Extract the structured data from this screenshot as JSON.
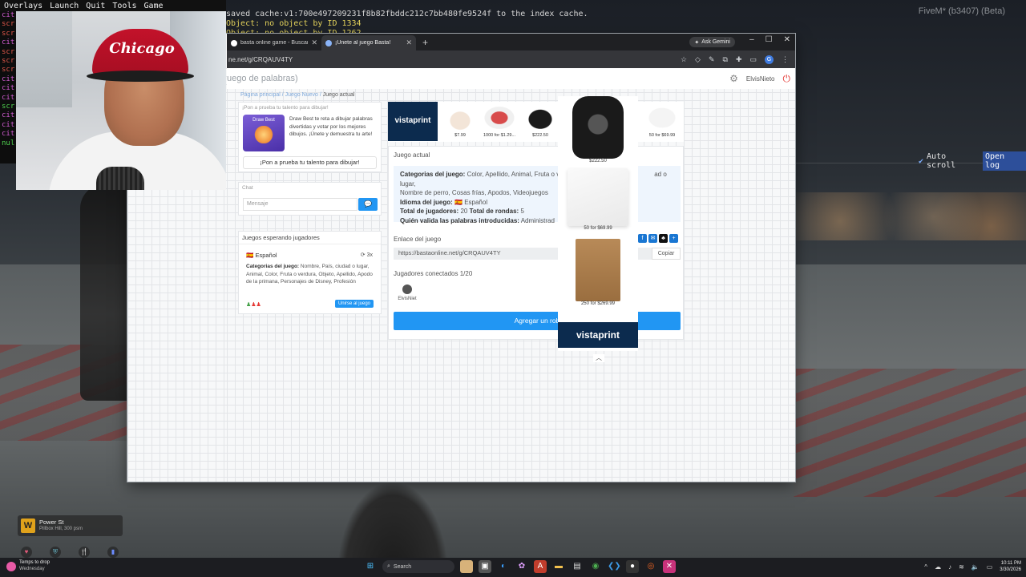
{
  "menubar": {
    "items": [
      "Overlays",
      "Launch",
      "Quit",
      "Tools",
      "Game"
    ]
  },
  "console_left": [
    {
      "t": "cit",
      "c": "#d15bd1"
    },
    {
      "t": "scr",
      "c": "#e0574a"
    },
    {
      "t": "scr",
      "c": "#e0574a"
    },
    {
      "t": "cit",
      "c": "#d15bd1"
    },
    {
      "t": "scr",
      "c": "#e0574a"
    },
    {
      "t": "scr",
      "c": "#e0574a"
    },
    {
      "t": "scr",
      "c": "#e0574a"
    },
    {
      "t": "cit",
      "c": "#d15bd1"
    },
    {
      "t": "cit",
      "c": "#d15bd1"
    },
    {
      "t": "cit",
      "c": "#d15bd1"
    },
    {
      "t": "scr",
      "c": "#4fd04f"
    },
    {
      "t": "cit",
      "c": "#d15bd1"
    },
    {
      "t": "cit",
      "c": "#d15bd1"
    },
    {
      "t": "cit",
      "c": "#d15bd1"
    },
    {
      "t": "nul",
      "c": "#4fd04f"
    }
  ],
  "console_top": [
    "saved cache:v1:700e497209231f8b82fbddc212c7bb480fe9524f to the index cache.",
    "Object: no object by ID 1334",
    "Object: no object by ID 1262"
  ],
  "fivem_label": "FiveM* (b3407) (Beta)",
  "console_controls": {
    "autoscroll": "Auto scroll",
    "openlog": "Open log"
  },
  "webcam": {
    "cap_text": "Chicago"
  },
  "browser": {
    "tabs": [
      {
        "label": "basta online game - Buscar con",
        "active": false
      },
      {
        "label": "¡Únete al juego Basta!",
        "active": true
      }
    ],
    "ask_gemini": "Ask Gemini",
    "url": "ne.net/g/CRQAUV4TY",
    "profile_initial": "G"
  },
  "site": {
    "brand": "uego de palabras)",
    "user": "ElvisNieto",
    "breadcrumb": [
      "Página principal",
      "Juego Nuevo",
      "Juego actual"
    ],
    "promo": {
      "header": "¡Pon a prueba tu talento para dibujar!",
      "image_label": "Draw Best",
      "desc": "Draw Best te reta a dibujar palabras divertidas y votar por los mejores dibujos. ¡Únete y demuestra tu arte!",
      "button": "¡Pon a prueba tu talento para dibujar!"
    },
    "chat": {
      "header": "Chat",
      "placeholder": "Mensaje"
    },
    "waiting": {
      "header": "Juegos esperando jugadores",
      "lang": "Español",
      "count": "3x",
      "cats_label": "Categorias del juego:",
      "cats": "Nombre, País, ciudad o lugar, Animal, Color, Fruta o verdura, Objeto, Apellido, Apodo de la primana, Personajes de Disney, Profesión",
      "join": "Unirse al juego"
    },
    "current": {
      "header": "Juego actual",
      "cats_label": "Categorias del juego:",
      "cats_a": "Color, Apellido, Animal, Fruta o v",
      "cats_b": "ad o lugar,",
      "cats_c": "Nombre de perro, Cosas frías, Apodos, Videojuegos",
      "idioma_label": "Idioma del juego:",
      "idioma": "Español",
      "total_label": "Total de jugadores:",
      "total": "20",
      "rondas_label": "Total de rondas:",
      "rondas": "5",
      "valida_label": "Quién valida las palabras introducidas:",
      "valida": "Administrad"
    },
    "enlace": {
      "header": "Enlace del juego",
      "url": "https://bastaonline.net/g/CRQAUV4TY",
      "copy": "Copiar"
    },
    "conectados": {
      "header": "Jugadores conectados 1/20",
      "player": "ElvisNiet"
    },
    "addbot": "Agregar un rob"
  },
  "ad": {
    "logo": "vistaprint",
    "strip": [
      {
        "price": "$7.99"
      },
      {
        "price": "1000 for $1.29..."
      },
      {
        "price": "$222.50"
      },
      {
        "price": "50 for $69.99"
      }
    ],
    "popup": [
      {
        "price": "$222.50"
      },
      {
        "price": "50 for $69.99"
      },
      {
        "price": "250 for $269.99"
      }
    ]
  },
  "notification": {
    "icon": "W",
    "title": "Power St",
    "sub": "Pillbox Hill, 300 psm"
  },
  "taskbar": {
    "weather_title": "Temps to drop",
    "weather_sub": "Wednesday",
    "search": "Search",
    "time": "10:11 PM",
    "date": "3/30/2026"
  }
}
